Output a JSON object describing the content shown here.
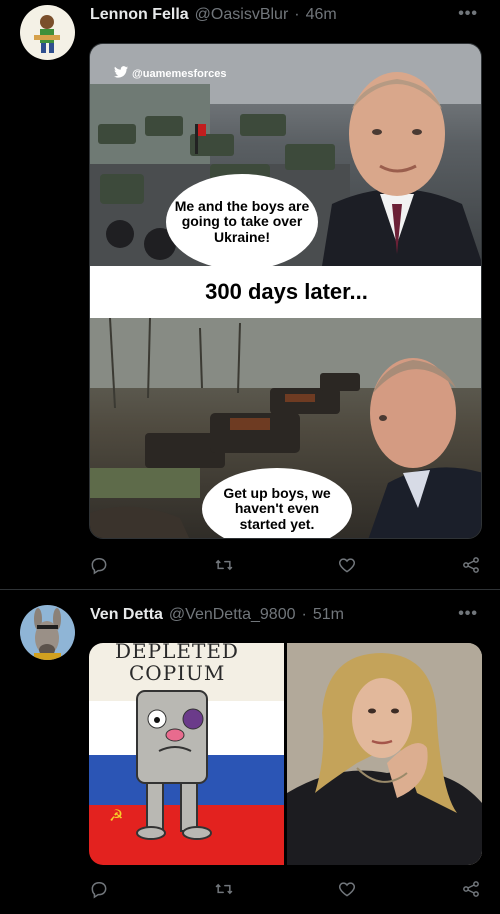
{
  "tweets": [
    {
      "display_name": "Lennon Fella",
      "handle": "@OasisvBlur",
      "separator": "·",
      "time": "46m",
      "more": "•••",
      "meme": {
        "watermark": "@uamemesforces",
        "bubble_top": "Me and the boys are going to take over Ukraine!",
        "middle_caption": "300 days later...",
        "bubble_bottom": "Get up boys, we haven't even started yet."
      }
    },
    {
      "display_name": "Ven Detta",
      "handle": "@VenDetta_9800",
      "separator": "·",
      "time": "51m",
      "more": "•••",
      "media": {
        "left_caption_line1": "DEPLETED",
        "left_caption_line2": "COPIUM"
      }
    }
  ],
  "colors": {
    "background": "#000000",
    "text_primary": "#e7e9ea",
    "text_secondary": "#71767b",
    "divider": "#2f3336"
  },
  "icons": {
    "reply": "reply-icon",
    "retweet": "retweet-icon",
    "like": "like-icon",
    "share": "share-icon"
  }
}
